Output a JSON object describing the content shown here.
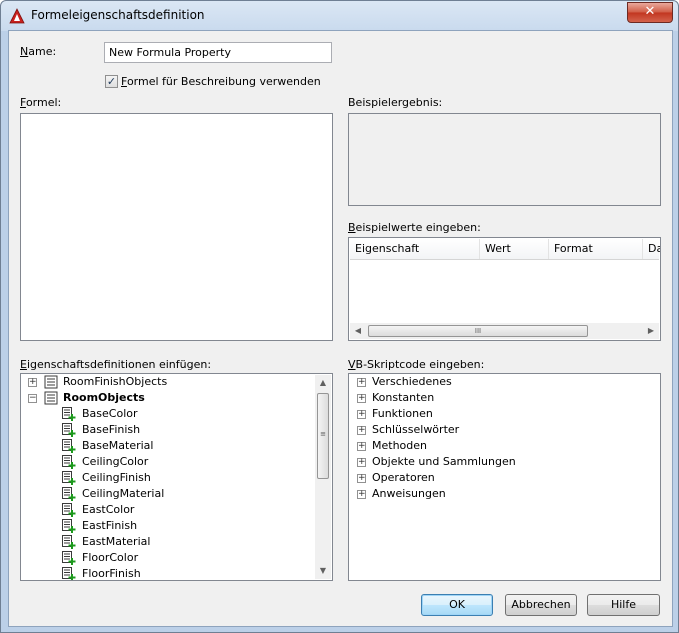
{
  "window": {
    "title": "Formeleigenschaftsdefinition",
    "close_glyph": "✕"
  },
  "name_field": {
    "label_first": "N",
    "label_rest": "ame:",
    "value": "New Formula Property"
  },
  "use_formula_checkbox": {
    "checked": true,
    "mark": "✓",
    "label_first": "F",
    "label_rest": "ormel für Beschreibung verwenden"
  },
  "formula": {
    "label_first": "F",
    "label_rest": "ormel:"
  },
  "sample_result": {
    "label": "Beispielergebnis:"
  },
  "sample_values": {
    "label_first": "B",
    "label_rest": "eispielwerte eingeben:",
    "columns": [
      "Eigenschaft",
      "Wert",
      "Format",
      "Da"
    ],
    "scroll_left": "◀",
    "scroll_right": "▶",
    "grip": "III"
  },
  "property_definitions": {
    "label_first": "E",
    "label_rest": "igenschaftsdefinitionen einfügen:",
    "groups": [
      {
        "name": "RoomFinishObjects",
        "expanded": false,
        "expander": "+"
      },
      {
        "name": "RoomObjects",
        "expanded": true,
        "expander": "−"
      }
    ],
    "items": [
      "BaseColor",
      "BaseFinish",
      "BaseMaterial",
      "CeilingColor",
      "CeilingFinish",
      "CeilingMaterial",
      "EastColor",
      "EastFinish",
      "EastMaterial",
      "FloorColor",
      "FloorFinish"
    ],
    "scroll_up": "▲",
    "scroll_down": "▼",
    "grip": "≡"
  },
  "vb_script": {
    "label_first": "V",
    "label_rest": "B-Skriptcode eingeben:",
    "expander": "+",
    "items": [
      "Verschiedenes",
      "Konstanten",
      "Funktionen",
      "Schlüsselwörter",
      "Methoden",
      "Objekte und Sammlungen",
      "Operatoren",
      "Anweisungen"
    ]
  },
  "buttons": {
    "ok": "OK",
    "cancel": "Abbrechen",
    "help": "Hilfe"
  },
  "colors": {
    "accent": "#3c7fb1",
    "close": "#c1341e",
    "plus_icon": "#1c9a1c"
  }
}
